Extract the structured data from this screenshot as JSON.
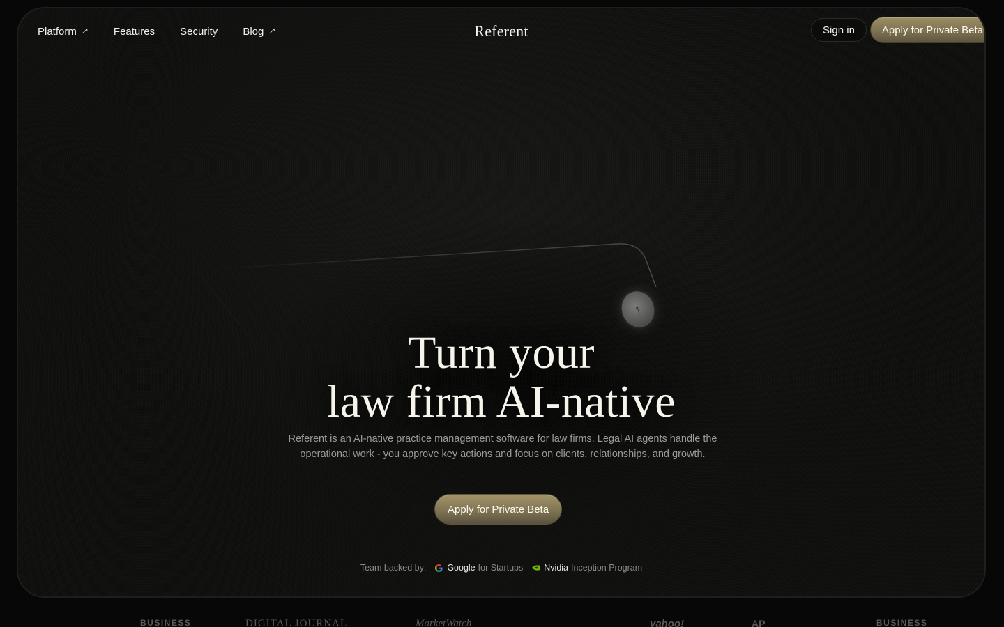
{
  "nav": {
    "links": [
      {
        "label": "Platform",
        "arrow": "↗"
      },
      {
        "label": "Features"
      },
      {
        "label": "Security"
      },
      {
        "label": "Blog",
        "arrow": "↗"
      }
    ],
    "logo": "Referent",
    "sign_in": "Sign in",
    "cta": "Apply for Private Beta"
  },
  "hero": {
    "title_line1": "Turn your",
    "title_line2": "law firm AI-native",
    "subtitle": "Referent is an AI-native practice management software for law firms. Legal AI agents handle the operational work - you approve key actions and focus on clients, relationships, and growth.",
    "cta": "Apply for Private Beta",
    "send_icon": "arrow-up-icon"
  },
  "backed": {
    "label": "Team backed by:",
    "google_brand": "Google",
    "google_program": "for Startups",
    "nvidia_brand": "Nvidia",
    "nvidia_program": "Inception Program"
  },
  "press": {
    "logos": [
      "BUSINESS",
      "DIGITAL JOURNAL",
      "MarketWatch",
      "yahoo!",
      "AP",
      "BUSINESS"
    ]
  },
  "colors": {
    "background": "#070707",
    "accent_gold": "#8a7d58",
    "text_primary": "#f7f4ec",
    "text_muted": "#9d9a93"
  }
}
